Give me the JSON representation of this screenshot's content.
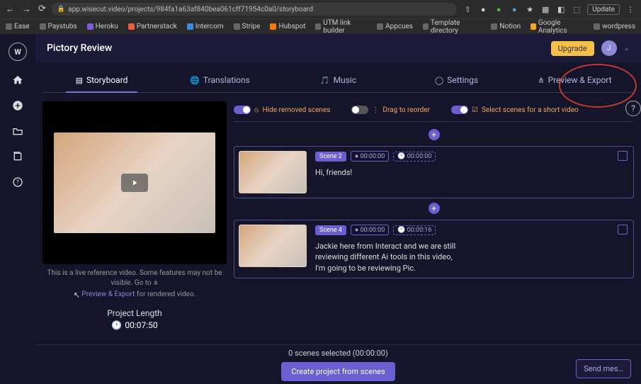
{
  "browser": {
    "url": "app.wisecut.video/projects/984fa1a63af840bea061cff71954c0a0/storyboard",
    "update_label": "Update",
    "bookmarks": [
      "Ease",
      "Paystubs",
      "Heroku",
      "Partnerstack",
      "Intercom",
      "Stripe",
      "Hubspot",
      "UTM link builder",
      "Appcues",
      "Template directory",
      "Notion",
      "Google Analytics",
      "wordpress"
    ]
  },
  "app": {
    "logo_text": "W",
    "project_title": "Pictory Review",
    "upgrade_label": "Upgrade",
    "avatar_initial": "J"
  },
  "tabs": {
    "storyboard": "Storyboard",
    "translations": "Translations",
    "music": "Music",
    "settings": "Settings",
    "preview_export": "Preview & Export"
  },
  "controls": {
    "hide_removed": "Hide removed scenes",
    "drag_reorder": "Drag to reorder",
    "select_short": "Select scenes for a short video"
  },
  "preview": {
    "caption_a": "This is a live reference video. Some features may not be visible. Go to",
    "caption_link": "Preview & Export",
    "caption_b": "for rendered video.",
    "length_label": "Project Length",
    "length_time": "00:07:50"
  },
  "scenes": [
    {
      "badge": "Scene 2",
      "time_a": "00:00:00",
      "time_b": "00:00:00",
      "text": "Hi, friends!"
    },
    {
      "badge": "Scene 4",
      "time_a": "00:00:00",
      "time_b": "00:00:16",
      "text": "Jackie here from Interact and we are still reviewing different Ai tools in this video, I'm going to be reviewing Pic."
    }
  ],
  "footer": {
    "selected": "0 scenes selected (00:00:00)",
    "create_btn": "Create project from scenes",
    "send_btn": "Send mes…"
  }
}
